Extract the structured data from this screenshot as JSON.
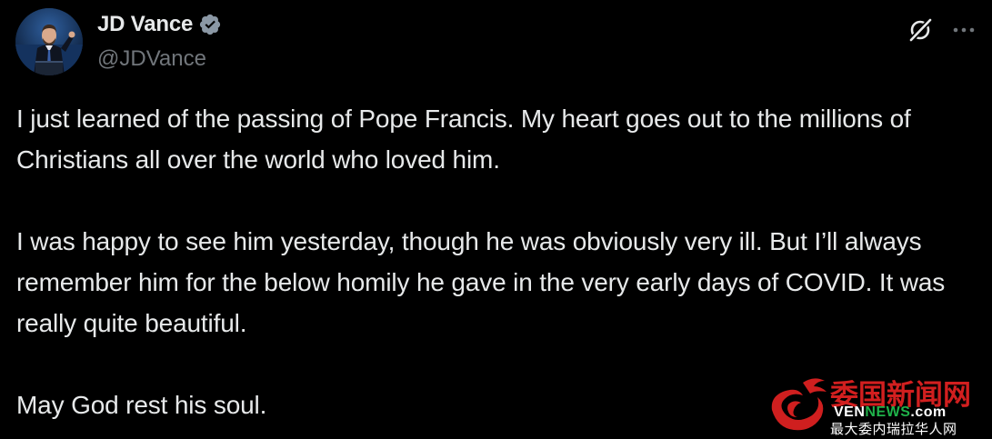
{
  "post": {
    "author": {
      "display_name": "JD Vance",
      "handle": "@JDVance",
      "verified": true,
      "verified_badge_color": "#8b98a5",
      "avatar": "avatar-photo-speaker-at-podium"
    },
    "header_icons": [
      "grok-icon",
      "more-icon"
    ],
    "text_paragraphs": [
      "I just learned of the passing of Pope Francis. My heart goes out to the millions of Christians all over the world who loved him.",
      "I was happy to see him yesterday, though he was obviously very ill. But I’ll always remember him for the below homily he gave in the very early days of COVID. It was really quite beautiful.",
      "May God rest his soul."
    ]
  },
  "watermark": {
    "title": "委国新闻网",
    "url_prefix": "VEN",
    "url_news": "NEWS",
    "url_suffix": ".com",
    "subtitle": "最大委内瑞拉华人网",
    "colors": {
      "title": "#d21f1f",
      "news": "#1fb24a",
      "url": "#ffffff"
    }
  },
  "theme": {
    "background": "#000000",
    "primary_text": "#e7e9ea",
    "secondary_text": "#71767b"
  }
}
